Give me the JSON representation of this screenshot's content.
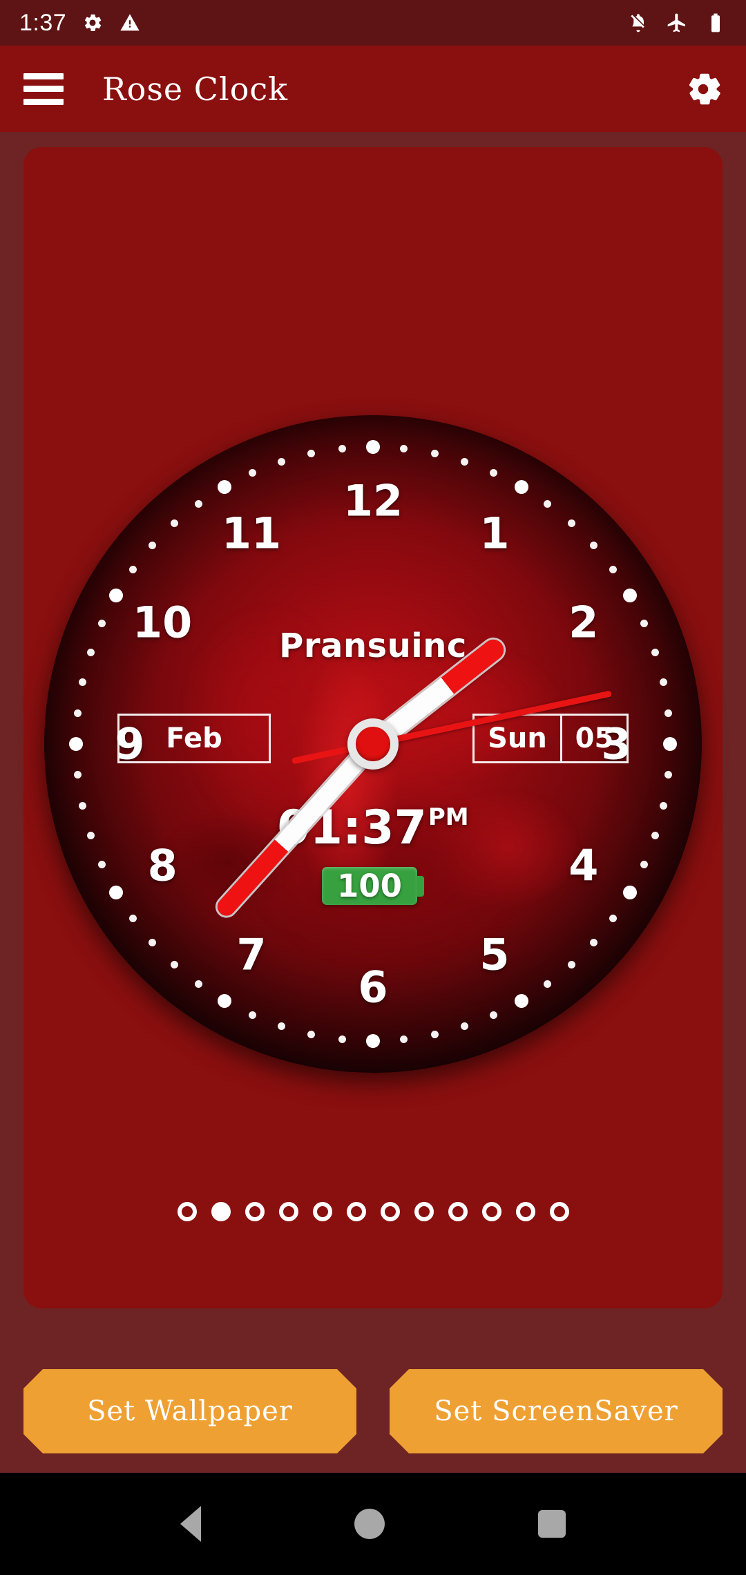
{
  "status_bar": {
    "time": "1:37",
    "left_icons": [
      "gear-icon",
      "warning-triangle-icon"
    ],
    "right_icons": [
      "notifications-off-icon",
      "airplane-mode-icon",
      "battery-full-icon"
    ],
    "background": "#5e1414"
  },
  "toolbar": {
    "menu_icon": "hamburger-menu-icon",
    "title": "Rose Clock",
    "settings_icon": "gear-icon",
    "background": "#8a0f0f"
  },
  "clock": {
    "brand": "Pransuinc",
    "numerals": [
      "1",
      "2",
      "3",
      "4",
      "5",
      "6",
      "7",
      "8",
      "9",
      "10",
      "11",
      "12"
    ],
    "month": "Feb",
    "weekday": "Sun",
    "day": "05",
    "digital_time": "01:37",
    "meridiem": "PM",
    "battery_percent": "100",
    "battery_color": "#37a13f",
    "hands": {
      "hour_angle_deg": 52,
      "minute_angle_deg": 222,
      "second_angle_deg": 78
    },
    "hand_colors": {
      "hand_body": "#fdfdfd",
      "hand_tip": "#ee1212",
      "second_hand": "#e81414",
      "hub": "#e01010"
    }
  },
  "pager": {
    "total": 12,
    "active_index": 1
  },
  "actions": {
    "set_wallpaper": "Set Wallpaper",
    "set_screensaver": "Set ScreenSaver",
    "button_color": "#efa033"
  },
  "nav_bar": {
    "back": "back-icon",
    "home": "home-icon",
    "recents": "recents-icon"
  },
  "theme": {
    "page_background": "#6e2424",
    "card_background": "#8a0f0f",
    "accent": "#efa033"
  }
}
